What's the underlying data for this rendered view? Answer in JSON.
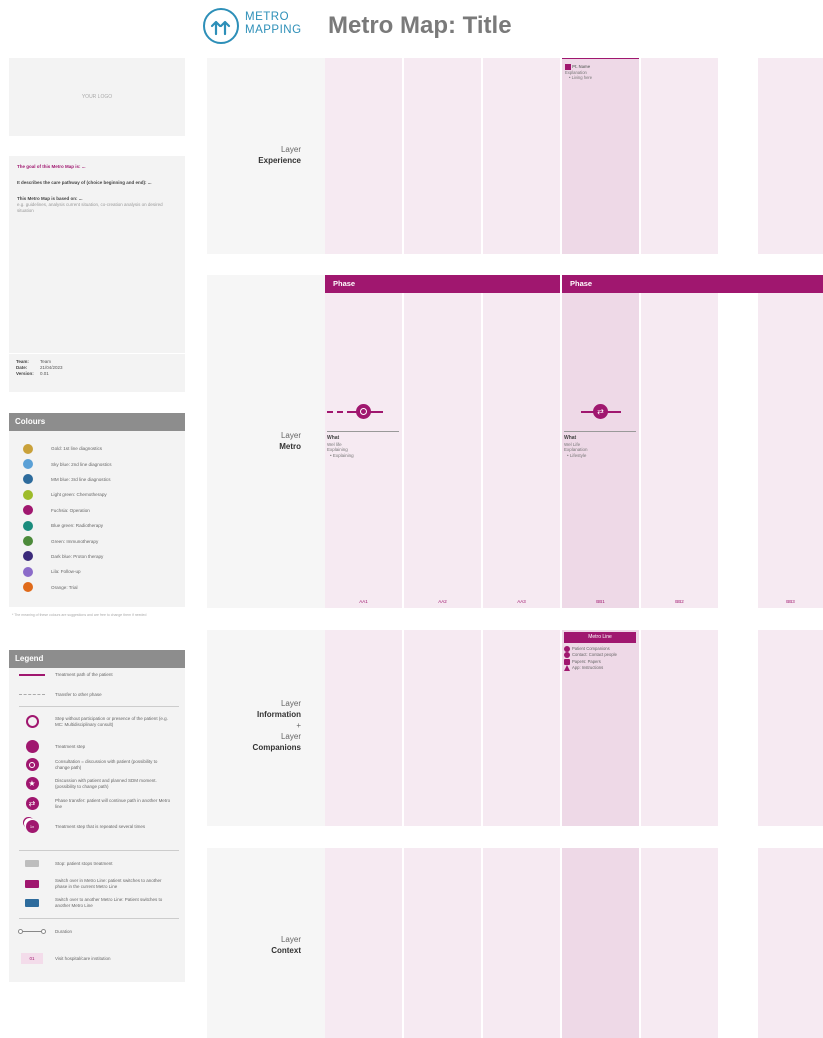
{
  "header": {
    "brand_line1": "METRO",
    "brand_line2": "MAPPING",
    "title": "Metro Map: Title"
  },
  "left": {
    "logo_placeholder": "YOUR LOGO",
    "info": {
      "goal": "The goal of this Metro Map is: ...",
      "describes": "It describes the care pathway of (choice beginning and end): ...",
      "based_on": "This Metro Map is based on: ...",
      "based_on_hint": "e.g. guidelines, analysis current situation, co-creation analysis on desired situation"
    },
    "meta": {
      "team_label": "Team:",
      "team_value": "Team",
      "date_label": "Date:",
      "date_value": "21/04/2023",
      "version_label": "Version:",
      "version_value": "0.01"
    },
    "colours": {
      "title": "Colours",
      "items": [
        {
          "color": "#c9a13a",
          "label": "Gold: 1st line diagnostics"
        },
        {
          "color": "#5aa0d6",
          "label": "Sky blue: 2nd line diagnostics"
        },
        {
          "color": "#2d6b9c",
          "label": "MM blue: 3rd line diagnostics"
        },
        {
          "color": "#9dbb2a",
          "label": "Light green: Chemotherapy"
        },
        {
          "color": "#a0176f",
          "label": "Fuchsia: Operation"
        },
        {
          "color": "#1b8c7d",
          "label": "Blue green: Radiotherapy"
        },
        {
          "color": "#4c8a3a",
          "label": "Green: Immunotherapy"
        },
        {
          "color": "#3b2a7a",
          "label": "Dark blue: Proton therapy"
        },
        {
          "color": "#8b6bc9",
          "label": "Lila: Follow-up"
        },
        {
          "color": "#e06a1a",
          "label": "Orange: Trial"
        }
      ],
      "note": "* The meaning of these colours are suggestions and are free to change them if needed"
    },
    "legend": {
      "title": "Legend",
      "items": [
        {
          "label": "Treatment path of the patient"
        },
        {
          "label": "Transfer to other phase"
        },
        {
          "label": "Step without participation or presence of the patient (e.g. MC: Multidisciplinary consult)"
        },
        {
          "label": "Treatment step"
        },
        {
          "label": "Consultation = discussion with patient (possibility to change path)"
        },
        {
          "label": "Discussion with patient and planned SDM moment. (possibility to change path)"
        },
        {
          "label": "Phase transfer: patient will continue path in another Metro line"
        },
        {
          "label": "Treatment step that is repeated several times"
        },
        {
          "label": "Stop: patient stops treatment"
        },
        {
          "label": "Switch over in Metro Line: patient switches to another phase in the current Metro Line"
        },
        {
          "label": "Switch over to another Metro Line: Patient switches to another Metro Line"
        },
        {
          "label": "Duration"
        },
        {
          "label": "Visit hospital/care institution"
        }
      ],
      "stop_symbol_text": "",
      "switch_symbol_text": "",
      "switch2_symbol_text": "",
      "visit_symbol_text": "01",
      "repeat_symbol_text": "1x"
    }
  },
  "grid": {
    "layers": [
      {
        "line1": "Layer",
        "line2": "Experience"
      },
      {
        "line1": "Layer",
        "line2": "Metro"
      },
      {
        "line1": "Layer",
        "line2": "Information",
        "line3": "+",
        "line4": "Layer",
        "line5": "Companions"
      },
      {
        "line1": "Layer",
        "line2": "Context"
      }
    ],
    "phases": [
      "Phase",
      "Phase"
    ],
    "col_codes": [
      "AA1",
      "AA2",
      "AA3",
      "BB1",
      "BB2",
      "BB3"
    ],
    "experience_card": {
      "title": "Pt. Name",
      "line1": "Explanation",
      "line2": "• Living here"
    },
    "stops": [
      {
        "title": "What",
        "sub1": "Wel life",
        "sub2": "Explaining",
        "sub3": "• Explaining"
      },
      {
        "title": "What",
        "sub1": "Wel Life",
        "sub2": "Explanation",
        "sub3": "• Lifestyle"
      }
    ],
    "metro_line_card": {
      "title": "Metro Line",
      "items": [
        "Patient Companions",
        "Contact: Contact people",
        "Papers: Papers",
        "App: Instructions"
      ]
    }
  }
}
